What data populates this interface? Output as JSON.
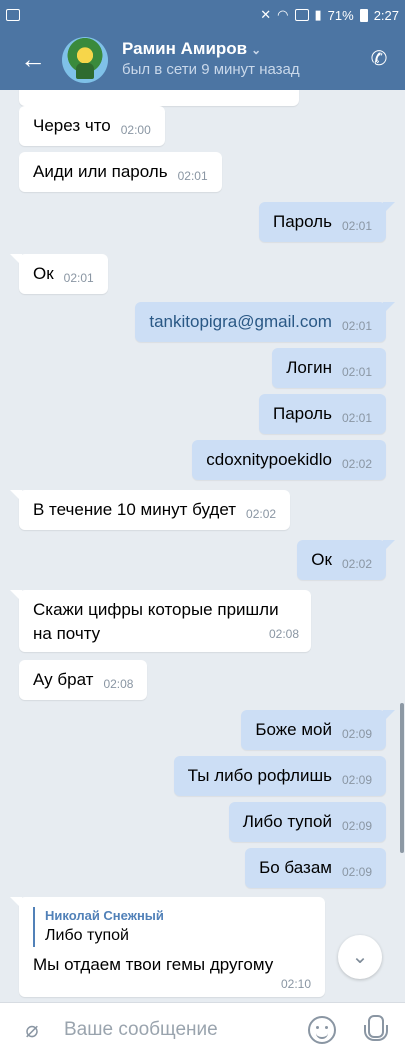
{
  "status_bar": {
    "battery": "71%",
    "time": "2:27"
  },
  "header": {
    "name": "Рамин Амиров",
    "chevron": "⌄",
    "status": "был в сети 9 минут назад",
    "back_icon": "arrow-left",
    "call_icon": "phone"
  },
  "messages": [
    {
      "text": "Через что",
      "time": "02:00",
      "dir": "in"
    },
    {
      "text": "Аиди или пароль",
      "time": "02:01",
      "dir": "in"
    },
    {
      "text": "Пароль",
      "time": "02:01",
      "dir": "out"
    },
    {
      "text": "Ок",
      "time": "02:01",
      "dir": "in"
    },
    {
      "text": "tankitopigra@gmail.com",
      "time": "02:01",
      "dir": "out"
    },
    {
      "text": "Логин",
      "time": "02:01",
      "dir": "out"
    },
    {
      "text": "Пароль",
      "time": "02:01",
      "dir": "out"
    },
    {
      "text": "cdoxnitypoekidlo",
      "time": "02:02",
      "dir": "out"
    },
    {
      "text": "В течение 10 минут будет",
      "time": "02:02",
      "dir": "in"
    },
    {
      "text": "Ок",
      "time": "02:02",
      "dir": "out"
    },
    {
      "text": "Скажи цифры которые пришли на почту",
      "time": "02:08",
      "dir": "in"
    },
    {
      "text": "Ау брат",
      "time": "02:08",
      "dir": "in"
    },
    {
      "text": "Боже мой",
      "time": "02:09",
      "dir": "out"
    },
    {
      "text": "Ты либо рофлишь",
      "time": "02:09",
      "dir": "out"
    },
    {
      "text": "Либо тупой",
      "time": "02:09",
      "dir": "out"
    },
    {
      "text": "Бо базам",
      "time": "02:09",
      "dir": "out"
    }
  ],
  "reply_message": {
    "quote_author": "Николай Снежный",
    "quote_text": "Либо тупой",
    "text": "Мы отдаем  твои гемы другому",
    "time": "02:10"
  },
  "input": {
    "placeholder": "Ваше сообщение"
  },
  "colors": {
    "header": "#4c75a3",
    "background": "#e7ecf1",
    "outgoing": "#ccdef5",
    "incoming": "#ffffff",
    "link": "#2a5885"
  }
}
